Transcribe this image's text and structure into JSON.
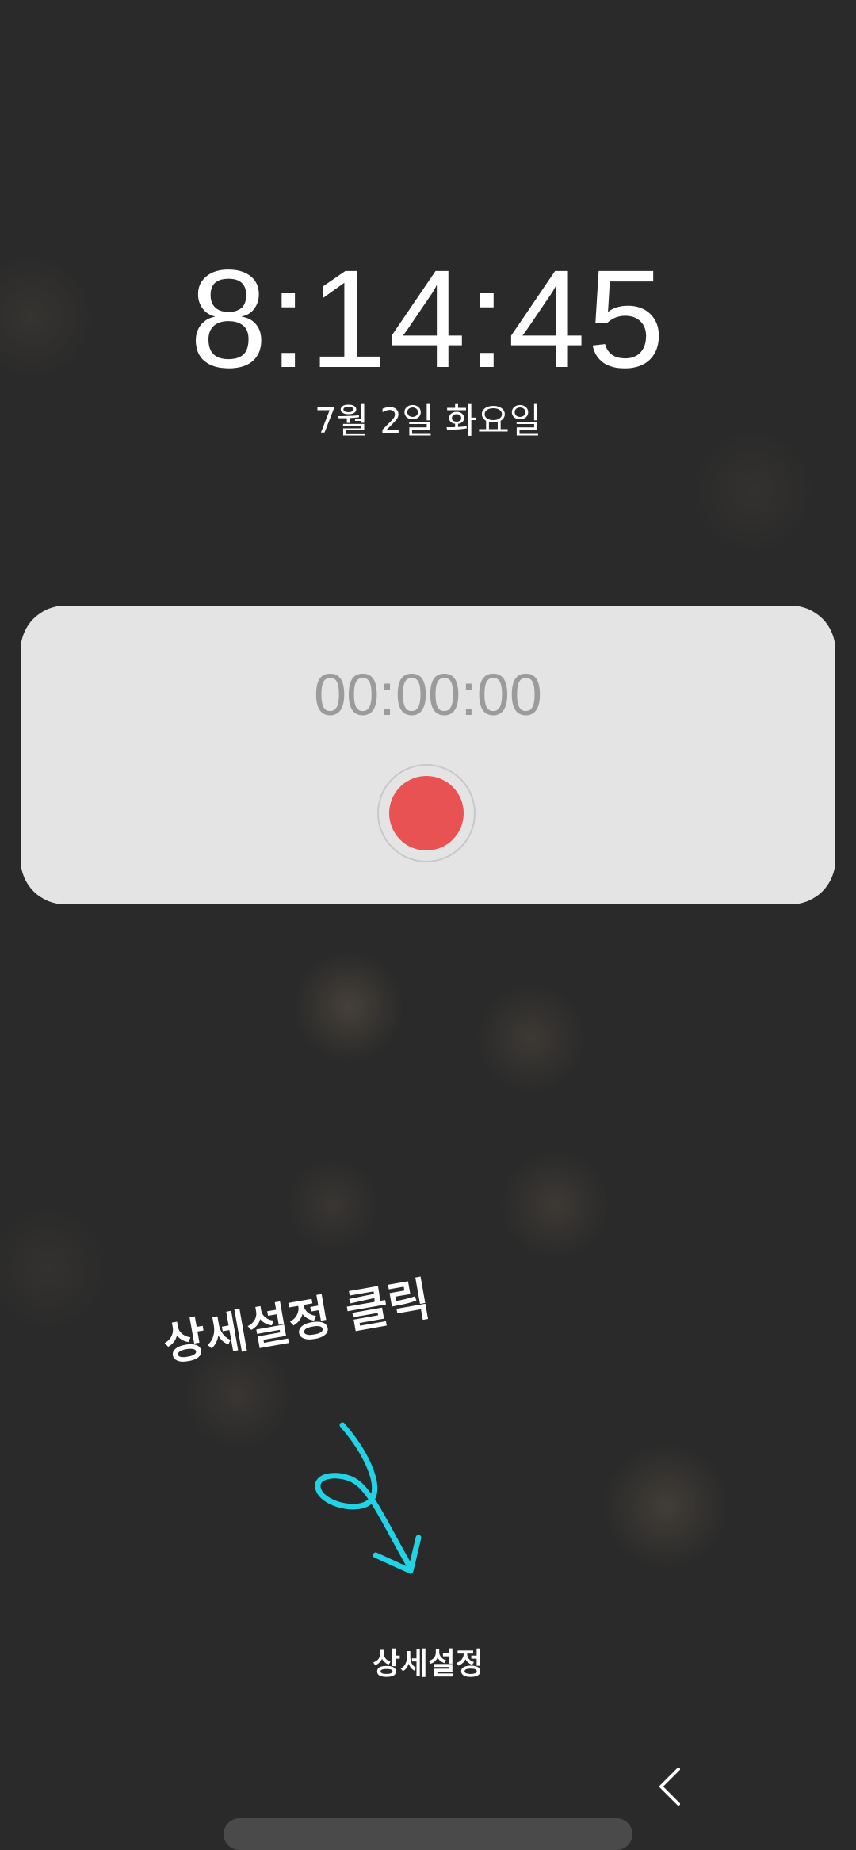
{
  "lockscreen": {
    "time": "8:14:45",
    "date": "7월 2일 화요일"
  },
  "recorder_card": {
    "timer": "00:00:00",
    "record_button_color": "#e95252"
  },
  "annotation": {
    "text": "상세설정 클릭",
    "arrow_color": "#22d3e6"
  },
  "bottom": {
    "settings_label": "상세설정"
  }
}
